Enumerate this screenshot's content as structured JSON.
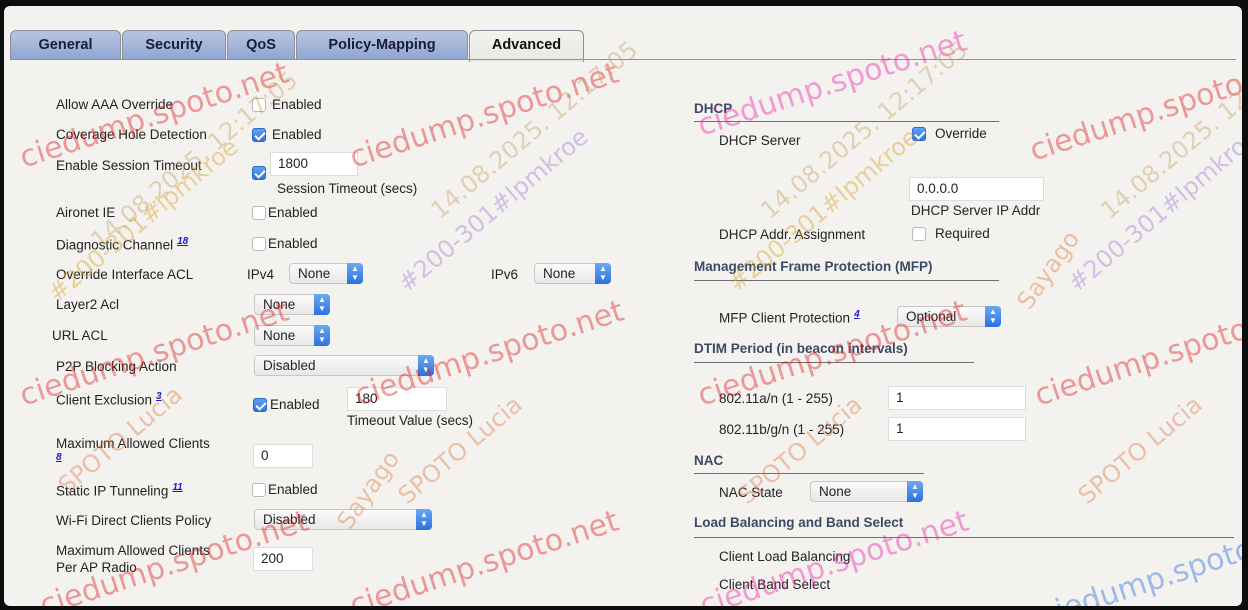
{
  "tabs": [
    {
      "label": "General"
    },
    {
      "label": "Security"
    },
    {
      "label": "QoS"
    },
    {
      "label": "Policy-Mapping"
    },
    {
      "label": "Advanced"
    }
  ],
  "left": {
    "allow_aaa_override": {
      "label": "Allow AAA Override",
      "checkbox_label": "Enabled",
      "checked": false
    },
    "coverage_hole_detection": {
      "label": "Coverage Hole Detection",
      "checkbox_label": "Enabled",
      "checked": true
    },
    "enable_session_timeout": {
      "label": "Enable Session Timeout",
      "checked": true,
      "value": "1800",
      "sublabel": "Session Timeout (secs)"
    },
    "aironet_ie": {
      "label": "Aironet IE",
      "checkbox_label": "Enabled",
      "checked": false
    },
    "diagnostic_channel": {
      "label": "Diagnostic Channel",
      "footnote": "18",
      "checkbox_label": "Enabled",
      "checked": false
    },
    "override_interface_acl": {
      "label": "Override Interface ACL",
      "ipv4_label": "IPv4",
      "ipv4_value": "None",
      "ipv6_label": "IPv6",
      "ipv6_value": "None"
    },
    "layer2_acl": {
      "label": "Layer2 Acl",
      "value": "None"
    },
    "url_acl": {
      "label": "URL ACL",
      "value": "None"
    },
    "p2p_blocking_action": {
      "label": "P2P Blocking Action",
      "value": "Disabled"
    },
    "client_exclusion": {
      "label": "Client Exclusion",
      "footnote": "3",
      "checkbox_label": "Enabled",
      "checked": true,
      "value": "180",
      "sublabel": "Timeout Value (secs)"
    },
    "maximum_allowed_clients": {
      "label": "Maximum Allowed Clients",
      "footnote": "8",
      "value": "0"
    },
    "static_ip_tunneling": {
      "label": "Static IP Tunneling",
      "footnote": "11",
      "checkbox_label": "Enabled",
      "checked": false
    },
    "wifi_direct_clients_policy": {
      "label": "Wi-Fi Direct Clients Policy",
      "value": "Disabled"
    },
    "max_clients_per_ap_radio": {
      "label_line1": "Maximum Allowed Clients",
      "label_line2": "Per AP Radio",
      "value": "200"
    }
  },
  "right": {
    "dhcp": {
      "heading": "DHCP",
      "server_label": "DHCP Server",
      "override_label": "Override",
      "override_checked": true,
      "ip_value": "0.0.0.0",
      "ip_sublabel": "DHCP Server IP Addr",
      "assignment_label": "DHCP Addr. Assignment",
      "required_label": "Required",
      "required_checked": false
    },
    "mfp": {
      "heading": "Management Frame Protection (MFP)",
      "label": "MFP Client Protection",
      "footnote": "4",
      "value": "Optional"
    },
    "dtim": {
      "heading": "DTIM Period (in beacon intervals)",
      "a_label": "802.11a/n (1 - 255)",
      "a_value": "1",
      "bg_label": "802.11b/g/n (1 - 255)",
      "bg_value": "1"
    },
    "nac": {
      "heading": "NAC",
      "state_label": "NAC State",
      "state_value": "None"
    },
    "load_balancing": {
      "heading": "Load Balancing and Band Select",
      "client_load_balancing_label": "Client Load Balancing",
      "client_band_select_label": "Client Band Select"
    }
  },
  "watermark": {
    "site": "ciedump.spoto.net",
    "line_a": "#200-301#lpmkroe",
    "line_b": "14.08.2025. 12:17:05",
    "line_c": "SPOTO Lucia",
    "line_d": "Sayago"
  }
}
